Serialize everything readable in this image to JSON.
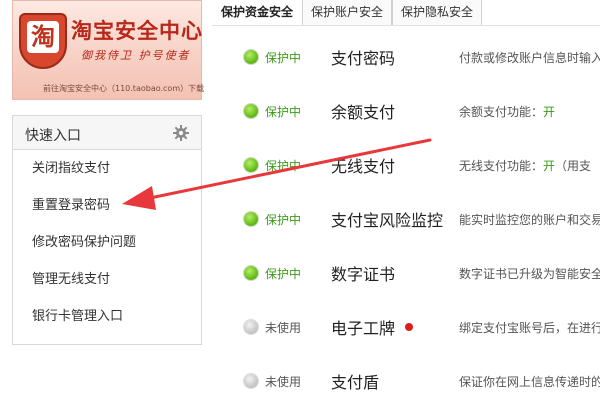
{
  "banner": {
    "shield_char": "淘",
    "title": "淘宝安全中心",
    "slogan": "御我侍卫  护号使者",
    "link": "前往淘宝安全中心（110.taobao.com）下载"
  },
  "quick": {
    "title": "快速入口",
    "items": [
      {
        "label": "关闭指纹支付"
      },
      {
        "label": "重置登录密码"
      },
      {
        "label": "修改密码保护问题"
      },
      {
        "label": "管理无线支付"
      },
      {
        "label": "银行卡管理入口"
      }
    ]
  },
  "tabs": [
    {
      "label": "保护资金安全",
      "active": true
    },
    {
      "label": "保护账户安全",
      "active": false
    },
    {
      "label": "保护隐私安全",
      "active": false
    }
  ],
  "rows": [
    {
      "status": "保护中",
      "name": "支付密码",
      "desc": "付款或修改账户信息时输入",
      "desc_flag": ""
    },
    {
      "status": "保护中",
      "name": "余额支付",
      "desc": "余额支付功能：",
      "desc_flag": "开"
    },
    {
      "status": "保护中",
      "name": "无线支付",
      "desc": "无线支付功能：",
      "desc_flag": "开",
      "desc_tail": "（用支"
    },
    {
      "status": "保护中",
      "name": "支付宝风险监控",
      "desc": "能实时监控您的账户和交易"
    },
    {
      "status": "保护中",
      "name": "数字证书",
      "desc": "数字证书已升级为智能安全"
    },
    {
      "status": "未使用",
      "name": "电子工牌",
      "desc": "绑定支付宝账号后，在进行"
    },
    {
      "status": "未使用",
      "name": "支付盾",
      "desc": "保证你在网上信息传递时的"
    }
  ],
  "colors": {
    "active_green": "#3d9a1b",
    "arrow_red": "#e8383b",
    "brand_red": "#b8281a"
  }
}
